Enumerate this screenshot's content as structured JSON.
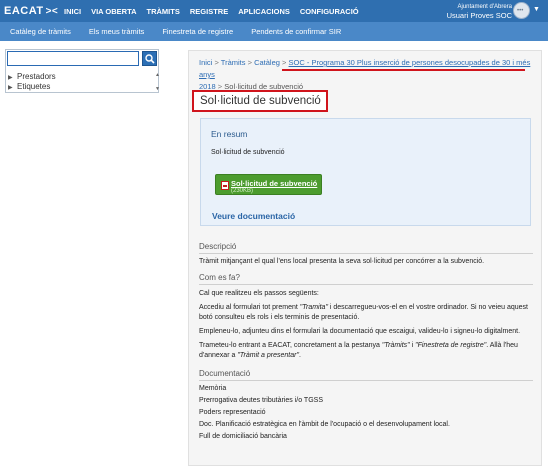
{
  "app": {
    "logo": "EACAT",
    "logo_mark": "><",
    "main_nav": [
      "INICI",
      "VIA OBERTA",
      "TRÀMITS",
      "REGISTRE",
      "APLICACIONS",
      "CONFIGURACIÓ"
    ],
    "user": {
      "organization": "Ajuntament d'Abrera",
      "name": "Usuari Proves SOC",
      "avatar_icon": "user-avatar-icon",
      "menu_icon": "chevron-down-icon"
    },
    "sub_nav": [
      "Catàleg de tràmits",
      "Els meus tràmits",
      "Finestreta de registre",
      "Pendents de confirmar SIR"
    ],
    "colors": {
      "topbar": "#2f6fb0",
      "subnav": "#4a88c8",
      "highlight": "#d0141c",
      "button": "#4c9c2e"
    }
  },
  "sidebar": {
    "search_placeholder": "",
    "search_icon": "search-icon",
    "tree": [
      {
        "label": "Prestadors",
        "icon": "caret-right-icon"
      },
      {
        "label": "Etiquetes",
        "icon": "caret-right-icon"
      }
    ]
  },
  "main": {
    "breadcrumb": {
      "inici": "Inici",
      "tramits": "Tràmits",
      "cataleg": "Catàleg",
      "programa_line1": "SOC - Programa 30 Plus inserció de persones desocupades de 30 i més anys",
      "programa_line2": "2018",
      "current": "Sol·licitud de subvenció",
      "separator": ">"
    },
    "title": "Sol·licitud de subvenció",
    "resum": {
      "heading": "En resum",
      "text": "Sol·licitud de subvenció",
      "button_label": "Sol·licitud de subvenció",
      "button_size": "(230KB)",
      "doc_link": "Veure documentació"
    },
    "descripcio": {
      "heading": "Descripció",
      "text": "Tràmit mitjançant el qual l'ens local presenta la seva sol·licitud per concórrer a la subvenció."
    },
    "com_es_fa": {
      "heading": "Com es fa?",
      "intro": "Cal que realitzeu els passos següents:",
      "p1_a": "Accediu al formulari tot prement ",
      "p1_em": "\"Tramita\"",
      "p1_b": " i descarregueu-vos-el en el vostre ordinador. Si no veieu aquest botó consulteu els rols i els terminis de presentació.",
      "p2": "Empleneu-lo, adjunteu dins el formulari la documentació que escaigui, valideu-lo i signeu-lo digitalment.",
      "p3_a": "Trameteu-lo entrant a EACAT, concretament a la pestanya ",
      "p3_em1": "\"Tràmits\"",
      "p3_b": " i ",
      "p3_em2": "\"Finestreta de registre\"",
      "p3_c": ". Allà l'heu d'annexar a ",
      "p3_em3": "\"Tràmit a presentar\"",
      "p3_d": "."
    },
    "documentacio": {
      "heading": "Documentació",
      "items": [
        "Memòria",
        "Prerrogativa deutes tributàries i/o TGSS",
        "Poders representació",
        "Doc. Planificació estratègica en l'àmbit de l'ocupació o el desenvolupament local.",
        "Full de domiciliació bancària"
      ]
    }
  }
}
